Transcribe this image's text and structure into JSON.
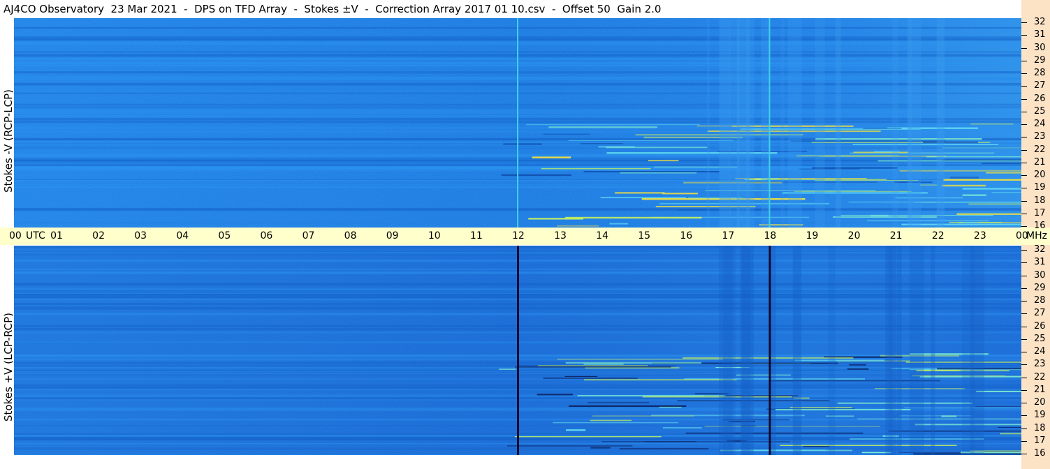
{
  "title": "AJ4CO Observatory  23 Mar 2021  -  DPS on TFD Array  -  Stokes ±V  -  Correction Array 2017 01 10.csv  -  Offset 50  Gain 2.0",
  "chart_data": {
    "type": "heatmap",
    "panels": [
      {
        "ylabel": "Stokes -V (RCP-LCP)"
      },
      {
        "ylabel": "Stokes +V (LCP-RCP)"
      }
    ],
    "time_ticks": [
      "00",
      "01",
      "02",
      "03",
      "04",
      "05",
      "06",
      "07",
      "08",
      "09",
      "10",
      "11",
      "12",
      "13",
      "14",
      "15",
      "16",
      "17",
      "18",
      "19",
      "20",
      "21",
      "22",
      "23",
      "00"
    ],
    "time_unit": "UTC",
    "freq_ticks": [
      "32",
      "31",
      "30",
      "29",
      "28",
      "27",
      "26",
      "25",
      "24",
      "23",
      "22",
      "21",
      "20",
      "19",
      "18",
      "17",
      "16"
    ],
    "freq_unit": "MHz",
    "x_range_utc_hours": [
      0,
      24
    ],
    "y_range_mhz": [
      16,
      32
    ],
    "marker_lines_utc": [
      12.0,
      18.0
    ],
    "colors": {
      "background_blue": "#1f7fe0",
      "right_strip": "#fde3c6",
      "time_bar": "#ffffcc",
      "top_marker": "#3fd0e8",
      "bottom_marker": "#0a0a30"
    }
  }
}
